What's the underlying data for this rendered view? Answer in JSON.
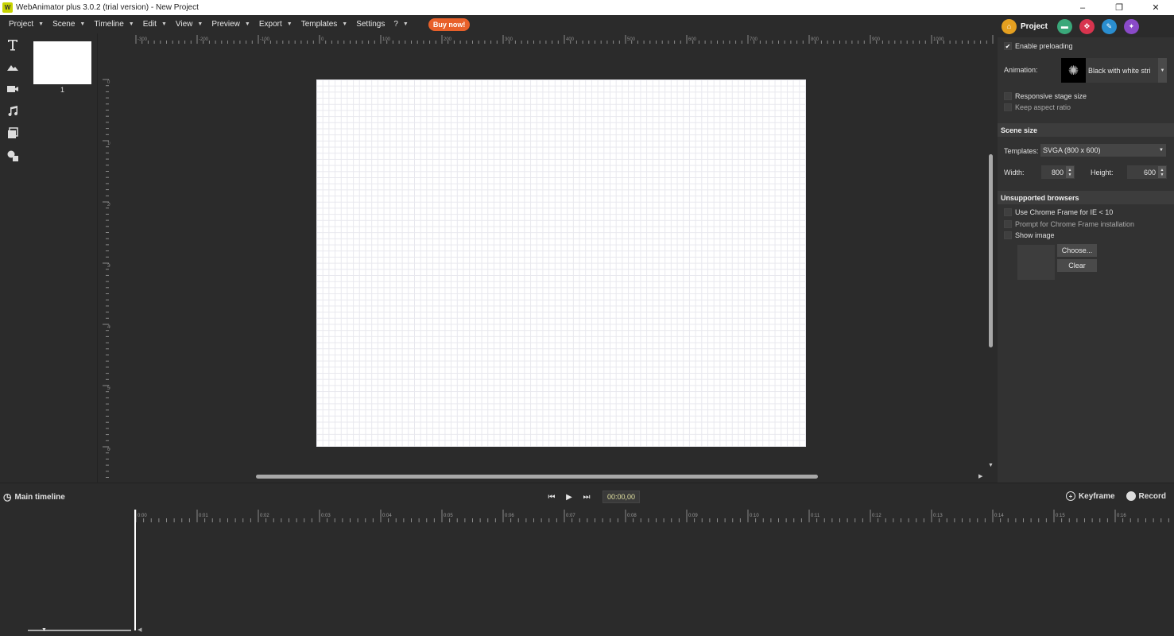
{
  "window": {
    "title": "WebAnimator plus 3.0.2 (trial version) - New Project",
    "icon_letter": "W",
    "controls": [
      "–",
      "❐",
      "✕"
    ]
  },
  "menu": {
    "items": [
      {
        "label": "Project",
        "caret": true
      },
      {
        "label": "Scene",
        "caret": true
      },
      {
        "label": "Timeline",
        "caret": true
      },
      {
        "label": "Edit",
        "caret": true
      },
      {
        "label": "View",
        "caret": true
      },
      {
        "label": "Preview",
        "caret": true
      },
      {
        "label": "Export",
        "caret": true
      },
      {
        "label": "Templates",
        "caret": true
      },
      {
        "label": "Settings",
        "caret": false
      },
      {
        "label": "?",
        "caret": true
      }
    ],
    "buy_label": "Buy now!",
    "buy_color": "#e8602a"
  },
  "tools": [
    "text-tool-icon",
    "image-tool-icon",
    "video-tool-icon",
    "audio-tool-icon",
    "layers-tool-icon",
    "shapes-tool-icon"
  ],
  "scenes": {
    "thumb_number": "1"
  },
  "rulers": {
    "top_labels": [
      "-300",
      "-200",
      "-100",
      "0",
      "100",
      "200",
      "300",
      "400",
      "500",
      "600",
      "700",
      "800",
      "900",
      "1000"
    ],
    "left_labels": [
      "0",
      "100",
      "200",
      "300",
      "400",
      "500",
      "600"
    ]
  },
  "panel": {
    "tab_project_label": "Project",
    "enable_preloading": {
      "label": "Enable preloading",
      "checked": true
    },
    "animation_label": "Animation:",
    "animation_value": "Black with white stri",
    "responsive": {
      "label": "Responsive stage size",
      "checked": false
    },
    "keep_aspect": {
      "label": "Keep aspect ratio",
      "checked": false
    },
    "scene_size_header": "Scene size",
    "templates_label": "Templates:",
    "templates_value": "SVGA (800 x 600)",
    "width_label": "Width:",
    "width_value": "800",
    "height_label": "Height:",
    "height_value": "600",
    "unsupported_header": "Unsupported browsers",
    "chrome_frame": {
      "label": "Use Chrome Frame for IE < 10",
      "checked": false
    },
    "prompt_chrome": {
      "label": "Prompt for Chrome Frame installation",
      "checked": false
    },
    "show_image": {
      "label": "Show image",
      "checked": false
    },
    "choose_label": "Choose...",
    "clear_label": "Clear"
  },
  "timeline": {
    "title": "Main timeline",
    "timecode": "00:00,00",
    "keyframe_label": "Keyframe",
    "record_label": "Record",
    "ticks": [
      "0:00",
      "0:01",
      "0:02",
      "0:03",
      "0:04",
      "0:05",
      "0:06",
      "0:07",
      "0:08",
      "0:09",
      "0:10",
      "0:11",
      "0:12",
      "0:13",
      "0:14",
      "0:15",
      "0:16"
    ]
  }
}
